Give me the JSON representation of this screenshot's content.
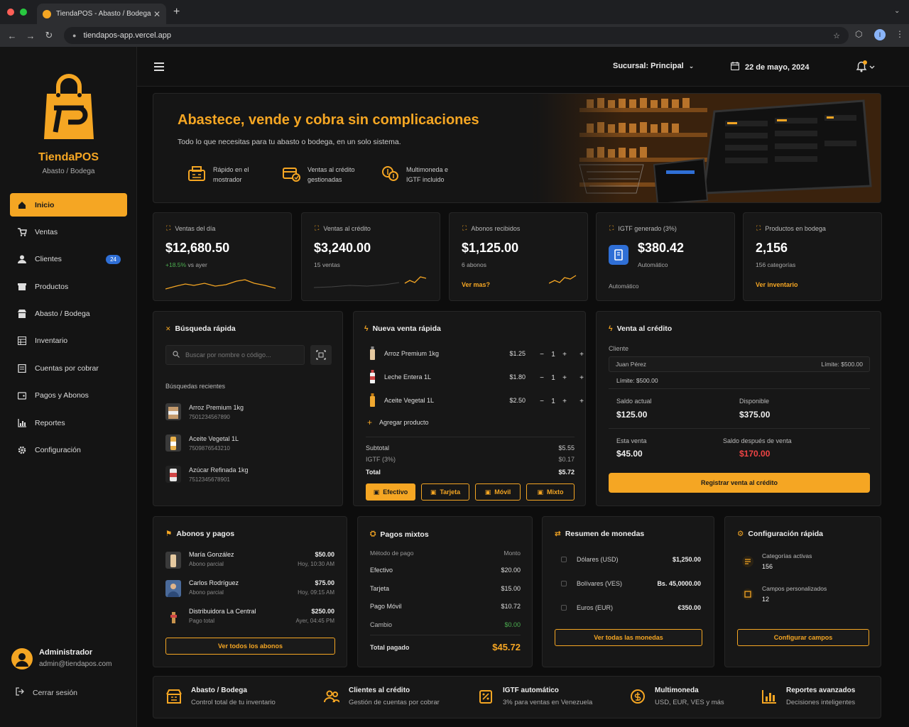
{
  "browser": {
    "tab_title": "TiendaPOS - Abasto / Bodega",
    "url": "tiendapos-app.vercel.app",
    "profile_initial": "I"
  },
  "sidebar": {
    "brand": "TiendaPOS",
    "brand_sub": "Abasto / Bodega",
    "items": [
      {
        "label": "Inicio",
        "icon": "home-icon",
        "active": true
      },
      {
        "label": "Ventas",
        "icon": "cart-icon"
      },
      {
        "label": "Clientes",
        "icon": "user-icon",
        "badge": "24"
      },
      {
        "label": "Productos",
        "icon": "box-icon"
      },
      {
        "label": "Abasto / Bodega",
        "icon": "store-icon"
      },
      {
        "label": "Inventario",
        "icon": "inventory-icon"
      },
      {
        "label": "Cuentas por cobrar",
        "icon": "receipt-icon"
      },
      {
        "label": "Pagos y Abonos",
        "icon": "wallet-icon"
      },
      {
        "label": "Reportes",
        "icon": "chart-icon"
      },
      {
        "label": "Configuración",
        "icon": "gear-icon"
      }
    ],
    "user_name": "Administrador",
    "user_email": "admin@tiendapos.com",
    "logout": "Cerrar sesión"
  },
  "topbar": {
    "branch": "Sucursal: Principal",
    "date": "22 de mayo, 2024"
  },
  "hero": {
    "title": "Abastece, vende y cobra sin complicaciones",
    "subtitle": "Todo lo que necesitas para tu abasto o bodega, en un solo sistema.",
    "features": [
      {
        "line1": "Rápido en el",
        "line2": "mostrador"
      },
      {
        "line1": "Ventas al crédito",
        "line2": "gestionadas"
      },
      {
        "line1": "Multimoneda e",
        "line2": "IGTF incluido"
      }
    ]
  },
  "stats": {
    "ventas_dia": {
      "label": "Ventas del día",
      "value": "$12,680.50",
      "change": "+18.5%",
      "change_note": "vs ayer"
    },
    "ventas_credito": {
      "label": "Ventas al crédito",
      "value": "$3,240.00",
      "note": "15 ventas"
    },
    "abonos": {
      "label": "Abonos recibidos",
      "value": "$1,125.00",
      "note": "6 abonos",
      "link": "Ver mas?"
    },
    "igtf": {
      "label": "IGTF generado (3%)",
      "value": "$380.42",
      "note": "Automático",
      "footer": "Automático"
    },
    "productos": {
      "label": "Productos en bodega",
      "value": "2,156",
      "note": "156 categorías",
      "link": "Ver inventario"
    }
  },
  "busqueda": {
    "title": "Búsqueda rápida",
    "placeholder": "Buscar por nombre o código...",
    "recent_label": "Búsquedas recientes",
    "recent": [
      {
        "name": "Arroz Premium 1kg",
        "code": "7501234567890"
      },
      {
        "name": "Aceite Vegetal 1L",
        "code": "7509876543210"
      },
      {
        "name": "Azúcar Refinada 1kg",
        "code": "7512345678901"
      }
    ]
  },
  "nueva_venta": {
    "title": "Nueva venta rápida",
    "items": [
      {
        "name": "Arroz Premium 1kg",
        "price": "$1.25",
        "qty": "1"
      },
      {
        "name": "Leche Entera 1L",
        "price": "$1.80",
        "qty": "1"
      },
      {
        "name": "Aceite Vegetal 1L",
        "price": "$2.50",
        "qty": "1"
      }
    ],
    "add": "Agregar producto",
    "subtotal_label": "Subtotal",
    "subtotal": "$5.55",
    "igtf_label": "IGTF (3%)",
    "igtf": "$0.17",
    "total_label": "Total",
    "total": "$5.72",
    "methods": [
      "Efectivo",
      "Tarjeta",
      "Móvil",
      "Mixto"
    ]
  },
  "credito": {
    "title": "Venta al crédito",
    "client_label": "Cliente",
    "client": "Juan Pérez",
    "limit_inline": "Límite: $500.00",
    "limit": "Límite: $500.00",
    "saldo_label": "Saldo actual",
    "saldo": "$125.00",
    "disp_label": "Disponible",
    "disp": "$375.00",
    "esta_label": "Esta venta",
    "esta": "$45.00",
    "despues_label": "Saldo después de venta",
    "despues": "$170.00",
    "button": "Registrar venta al crédito"
  },
  "abonos_pagos": {
    "title": "Abonos y pagos",
    "rows": [
      {
        "name": "María González",
        "type": "Abono parcial",
        "amount": "$50.00",
        "time": "Hoy, 10:30 AM"
      },
      {
        "name": "Carlos Rodríguez",
        "type": "Abono parcial",
        "amount": "$75.00",
        "time": "Hoy, 09:15 AM"
      },
      {
        "name": "Distribuidora La Central",
        "type": "Pago total",
        "amount": "$250.00",
        "time": "Ayer, 04:45 PM"
      }
    ],
    "button": "Ver todos los abonos"
  },
  "pagos_mixtos": {
    "title": "Pagos mixtos",
    "col1": "Método de pago",
    "col2": "Monto",
    "rows": [
      {
        "m": "Efectivo",
        "v": "$20.00"
      },
      {
        "m": "Tarjeta",
        "v": "$15.00"
      },
      {
        "m": "Pago Móvil",
        "v": "$10.72"
      },
      {
        "m": "Cambio",
        "v": "$0.00"
      }
    ],
    "total_label": "Total pagado",
    "total": "$45.72"
  },
  "monedas": {
    "title": "Resumen de monedas",
    "rows": [
      {
        "n": "Dólares (USD)",
        "v": "$1,250.00"
      },
      {
        "n": "Bolívares (VES)",
        "v": "Bs. 45,0000.00"
      },
      {
        "n": "Euros (EUR)",
        "v": "€350.00"
      }
    ],
    "button": "Ver todas las monedas"
  },
  "config": {
    "title": "Configuración rápida",
    "rows": [
      {
        "l": "Categorías activas",
        "v": "156"
      },
      {
        "l": "Campos personalizados",
        "v": "12"
      }
    ],
    "button": "Configurar campos"
  },
  "footer": [
    {
      "t": "Abasto / Bodega",
      "s": "Control total de tu inventario"
    },
    {
      "t": "Clientes al crédito",
      "s": "Gestión de cuentas por cobrar"
    },
    {
      "t": "IGTF automático",
      "s": "3% para ventas en Venezuela"
    },
    {
      "t": "Multimoneda",
      "s": "USD, EUR, VES y más"
    },
    {
      "t": "Reportes avanzados",
      "s": "Decisiones inteligentes"
    }
  ],
  "colors": {
    "accent": "#f5a623",
    "bg": "#0d0d0d",
    "card": "#171717",
    "green": "#4caf50",
    "red": "#ef4444",
    "blue": "#2f6fd6"
  }
}
